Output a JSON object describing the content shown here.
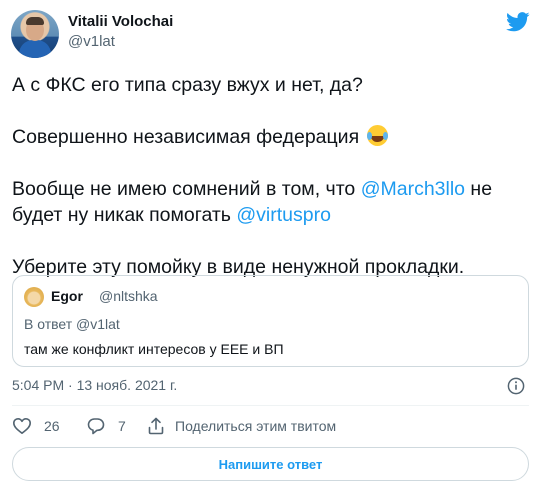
{
  "author": {
    "name": "Vitalii Volochai",
    "handle": "@v1lat"
  },
  "tweet": {
    "lines": [
      {
        "text": "А с ФКС его типа сразу вжух и нет, да?"
      },
      {
        "text": "Совершенно независимая федерация",
        "emoji": "face-with-tears-of-joy"
      },
      {
        "part1": "Вообще не имею сомнений в том, что ",
        "mention1": "@March3llo",
        "part2": " не будет ну никак помогать ",
        "mention2": "@virtuspro"
      },
      {
        "text": "Уберите эту помойку в виде ненужной прокладки."
      }
    ]
  },
  "quote": {
    "name": "Egor",
    "handle": "@nltshka",
    "reply_to": "В ответ @v1lat",
    "text": "там же конфликт интересов у ЕЕЕ и ВП"
  },
  "timestamp": "5:04 PM · 13 нояб. 2021 г.",
  "actions": {
    "likes": "26",
    "replies": "7",
    "share_label": "Поделиться этим твитом"
  },
  "reply_button": "Напишите ответ",
  "colors": {
    "accent": "#1d9bf0",
    "text": "#0f1419",
    "secondary": "#536471",
    "border": "#cfd9de"
  },
  "icons": [
    "twitter-bird-icon",
    "info-icon",
    "heart-icon",
    "reply-bubble-icon",
    "share-icon"
  ]
}
